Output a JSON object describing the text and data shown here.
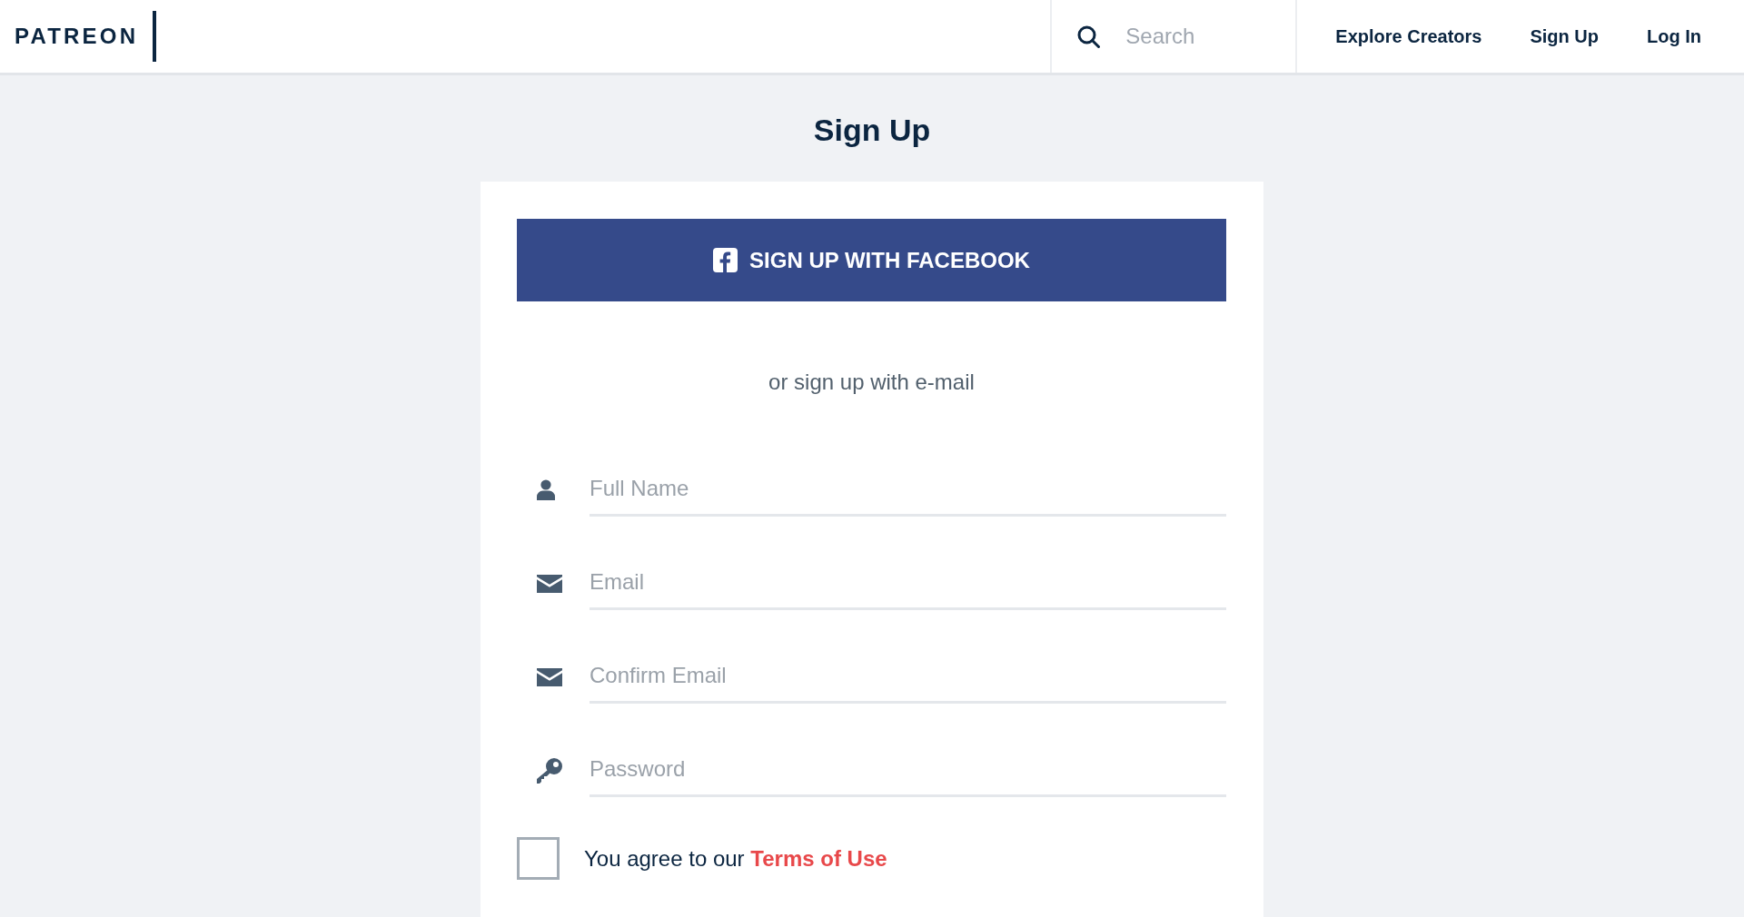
{
  "header": {
    "logo": "PATREON",
    "search": {
      "placeholder": "Search"
    },
    "nav": [
      {
        "label": "Explore Creators"
      },
      {
        "label": "Sign Up"
      },
      {
        "label": "Log In"
      }
    ]
  },
  "page_title": "Sign Up",
  "signup_form": {
    "facebook_button": "SIGN UP WITH FACEBOOK",
    "alternative_text": "or sign up with e-mail",
    "fields": [
      {
        "kind": "name",
        "placeholder": "Full Name"
      },
      {
        "kind": "email",
        "placeholder": "Email"
      },
      {
        "kind": "email",
        "placeholder": "Confirm Email"
      },
      {
        "kind": "password",
        "placeholder": "Password"
      }
    ],
    "terms": {
      "checked": false,
      "text": "You agree to our",
      "link": "Terms of Use"
    }
  }
}
